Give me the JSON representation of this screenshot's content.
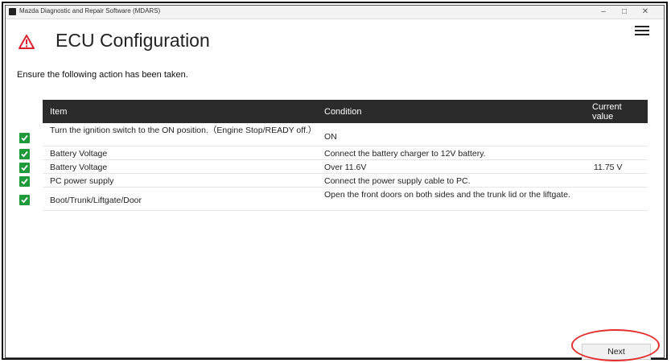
{
  "window": {
    "title": "Mazda Diagnostic and Repair Software (MDARS)",
    "minimize_glyph": "–",
    "maximize_glyph": "□",
    "close_glyph": "✕"
  },
  "header": {
    "title": "ECU Configuration",
    "warning_icon": "warning-triangle-icon",
    "warning_color": "#d9232e",
    "menu_icon": "hamburger-menu-icon"
  },
  "main": {
    "instruction": "Ensure the following action has been taken.",
    "table": {
      "columns": {
        "item": "Item",
        "condition": "Condition",
        "current_value": "Current\nvalue"
      },
      "rows": [
        {
          "checked": true,
          "item": "Turn the ignition switch to the ON position.（Engine Stop/READY off.）",
          "condition": "ON",
          "current_value": ""
        },
        {
          "checked": true,
          "item": "Battery Voltage",
          "condition": "Connect the battery charger to 12V battery.",
          "current_value": ""
        },
        {
          "checked": true,
          "item": "Battery Voltage",
          "condition": "Over 11.6V",
          "current_value": "11.75 V"
        },
        {
          "checked": true,
          "item": "PC power supply",
          "condition": "Connect the power supply cable to PC.",
          "current_value": ""
        },
        {
          "checked": true,
          "item": "Boot/Trunk/Liftgate/Door",
          "condition": "Open the front doors on both sides and the trunk lid or the liftgate.",
          "current_value": ""
        }
      ]
    }
  },
  "footer": {
    "next_label": "Next",
    "highlight_color": "#e3302f"
  },
  "colors": {
    "header_row": "#2b2b2b",
    "check_green": "#1f9a3a"
  }
}
